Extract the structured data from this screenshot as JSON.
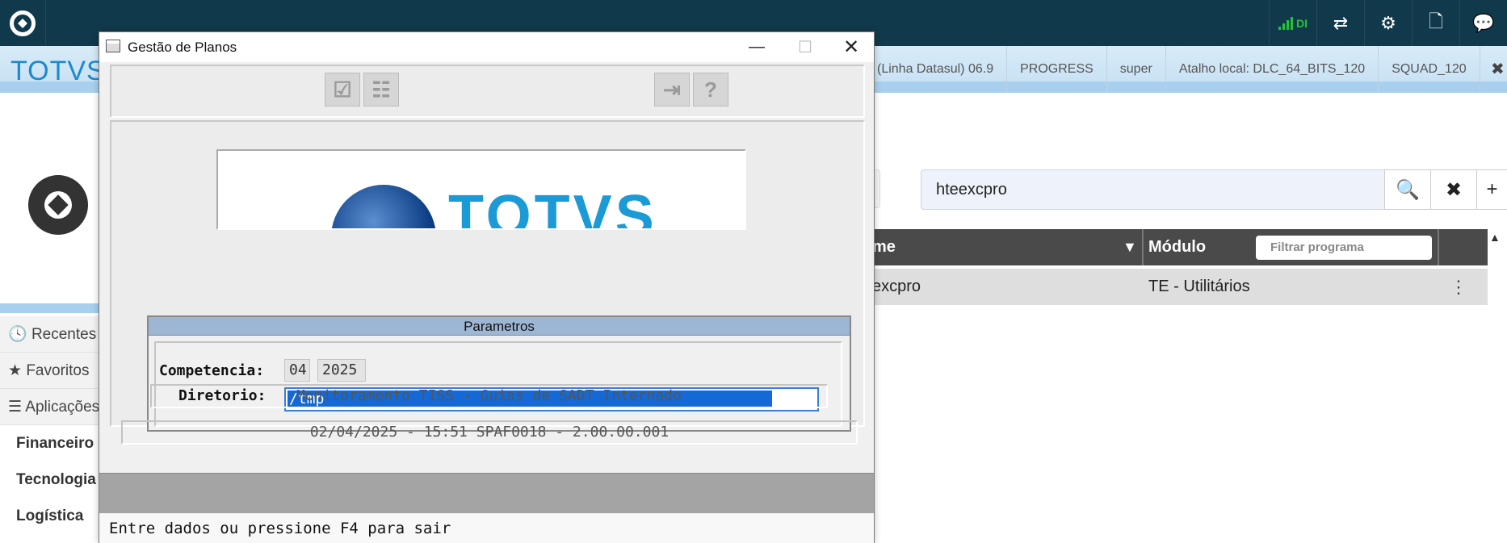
{
  "app": {
    "brand": "TOTVS",
    "info_items": [
      "(Linha Datasul) 06.9",
      "PROGRESS",
      "super",
      "Atalho local: DLC_64_BITS_120",
      "SQUAD_120"
    ],
    "info_close": "✖",
    "signal_label": "DI",
    "top_icons": [
      "shuffle-icon",
      "gear-icon",
      "document-icon",
      "chat-icon"
    ]
  },
  "sidebar": {
    "items": [
      {
        "icon": "🕓",
        "label": "Recentes"
      },
      {
        "icon": "★",
        "label": "Favoritos"
      },
      {
        "icon": "☰",
        "label": "Aplicações"
      }
    ],
    "groups": [
      "Financeiro",
      "Tecnologia",
      "Logística"
    ]
  },
  "search": {
    "value": "hteexcpro",
    "search_glyph": "🔍",
    "clear_glyph": "✖",
    "add_glyph": "+"
  },
  "table": {
    "headers": [
      "me",
      "Módulo"
    ],
    "filter_placeholder": "Filtrar programa",
    "rows": [
      {
        "name": "excpro",
        "module": "TE - Utilitários"
      }
    ]
  },
  "dialog": {
    "title": "Gestão de Planos",
    "params_title": "Parametros",
    "competencia_label": "Competencia:",
    "competencia_month": "04",
    "competencia_year": "2025",
    "diretorio_label": "Diretorio:",
    "diretorio_value": "/tmp",
    "info_line": "Monitoramento TISS - Guias de SADT Internado",
    "version_line": "02/04/2025 - 15:51  SPAF0018 - 2.00.00.001",
    "status_text": "Entre dados ou pressione F4 para sair",
    "logo_text": "TOTVS"
  }
}
